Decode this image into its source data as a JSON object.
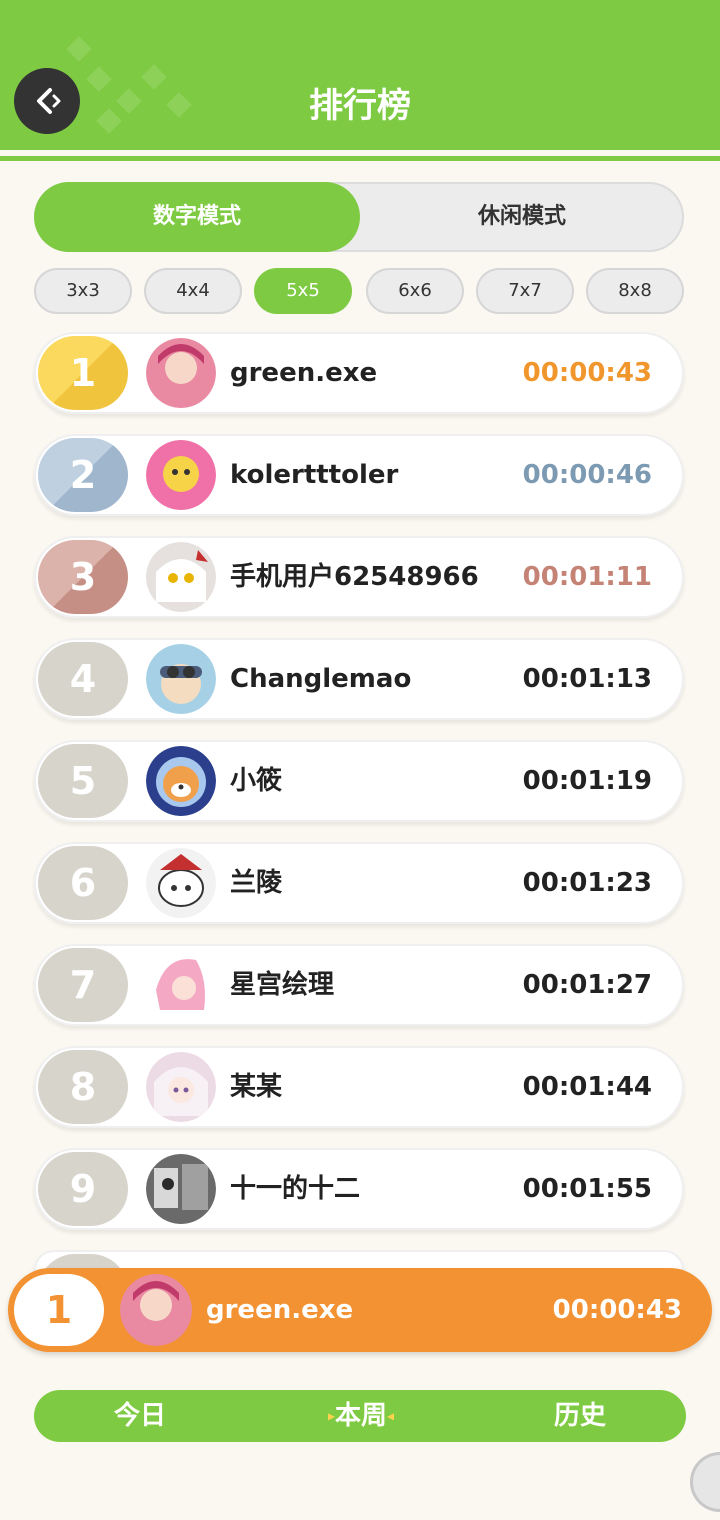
{
  "header": {
    "title": "排行榜"
  },
  "modes": [
    {
      "label": "数字模式",
      "active": true
    },
    {
      "label": "休闲模式",
      "active": false
    }
  ],
  "sizes": [
    {
      "label": "3x3",
      "active": false
    },
    {
      "label": "4x4",
      "active": false
    },
    {
      "label": "5x5",
      "active": true
    },
    {
      "label": "6x6",
      "active": false
    },
    {
      "label": "7x7",
      "active": false
    },
    {
      "label": "8x8",
      "active": false
    }
  ],
  "leaderboard": [
    {
      "rank": "1",
      "name": "green.exe",
      "time": "00:00:43",
      "time_color": "#f0962c",
      "avatar_color": "#e98aa2"
    },
    {
      "rank": "2",
      "name": "kolertttoler",
      "time": "00:00:46",
      "time_color": "#7d9ab3",
      "avatar_color": "#f7d348"
    },
    {
      "rank": "3",
      "name": "手机用户62548966",
      "time": "00:01:11",
      "time_color": "#c58376",
      "avatar_color": "#e6e1de"
    },
    {
      "rank": "4",
      "name": "Changlemao",
      "time": "00:01:13",
      "time_color": "#222222",
      "avatar_color": "#a6d0e6"
    },
    {
      "rank": "5",
      "name": "小筱",
      "time": "00:01:19",
      "time_color": "#222222",
      "avatar_color": "#f0a04a"
    },
    {
      "rank": "6",
      "name": "兰陵",
      "time": "00:01:23",
      "time_color": "#222222",
      "avatar_color": "#e7e7e7"
    },
    {
      "rank": "7",
      "name": "星宫绘理",
      "time": "00:01:27",
      "time_color": "#222222",
      "avatar_color": "#f4a8c4"
    },
    {
      "rank": "8",
      "name": "某某",
      "time": "00:01:44",
      "time_color": "#222222",
      "avatar_color": "#ecdbe5"
    },
    {
      "rank": "9",
      "name": "十一的十二",
      "time": "00:01:55",
      "time_color": "#222222",
      "avatar_color": "#6a6a6a"
    }
  ],
  "my_rank": {
    "rank": "1",
    "name": "green.exe",
    "time": "00:00:43"
  },
  "periods": [
    {
      "label": "今日",
      "active": false
    },
    {
      "label": "本周",
      "active": true
    },
    {
      "label": "历史",
      "active": false
    }
  ],
  "colors": {
    "brand_green": "#7ecb43",
    "highlight_orange": "#f39232"
  }
}
